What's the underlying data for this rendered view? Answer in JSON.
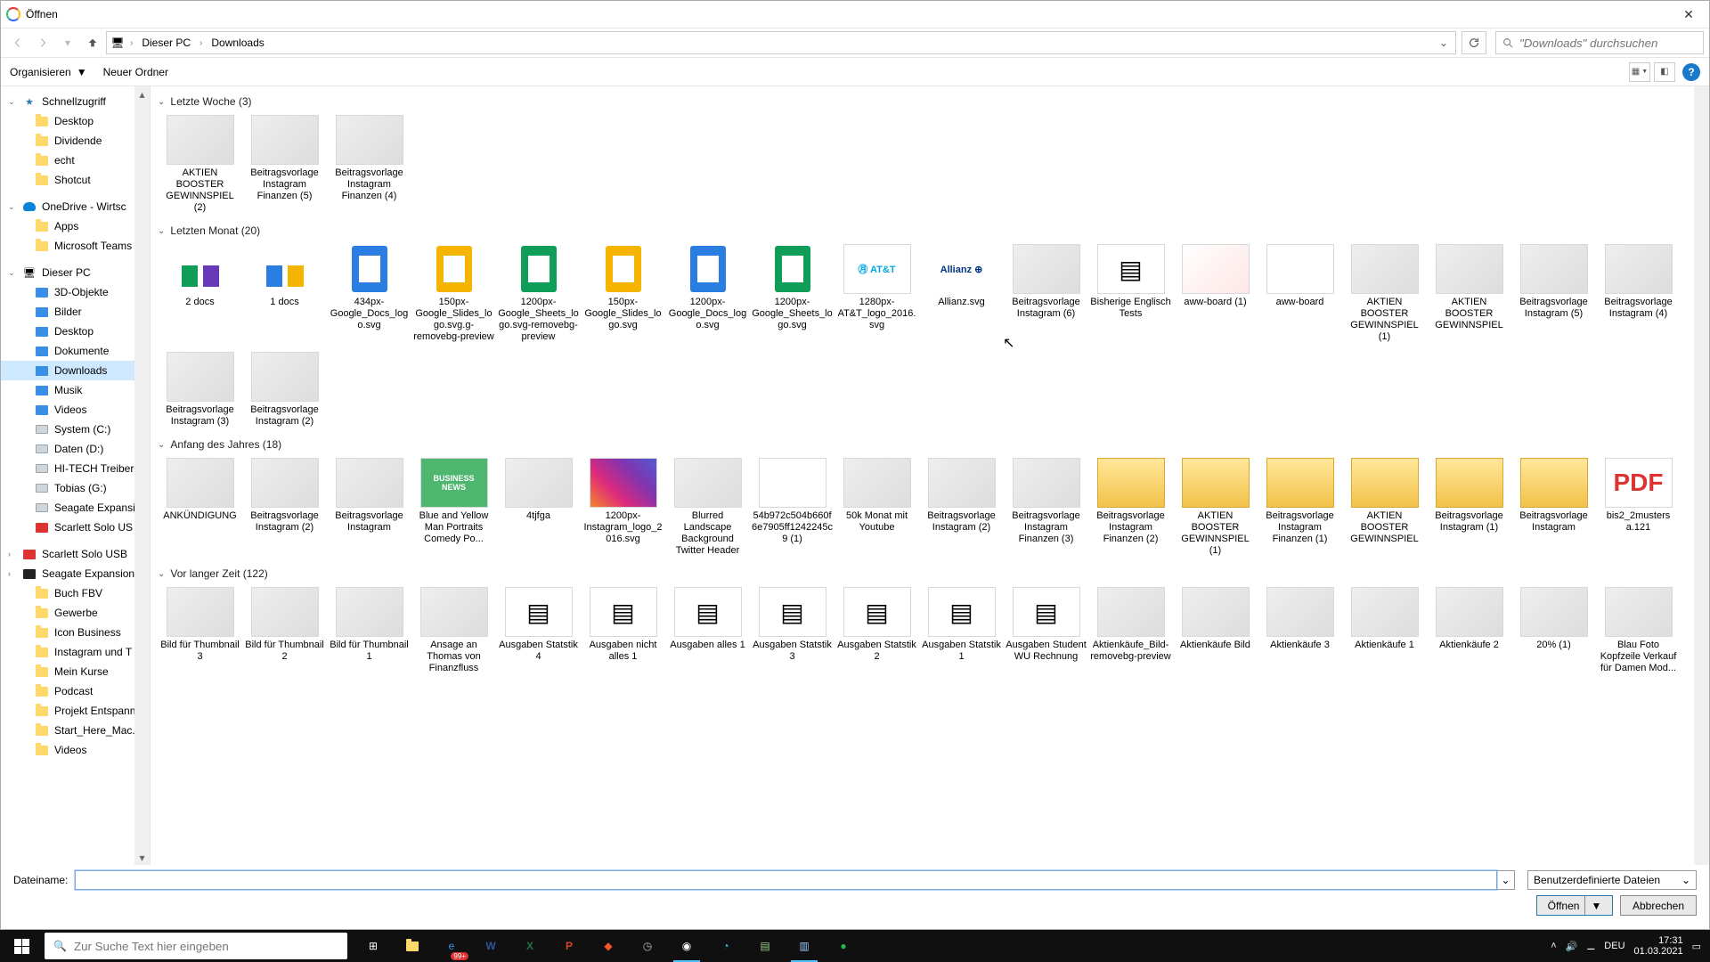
{
  "window": {
    "title": "Öffnen"
  },
  "nav": {
    "path_root_icon": "pc",
    "crumbs": [
      "Dieser PC",
      "Downloads"
    ],
    "search_placeholder": "\"Downloads\" durchsuchen"
  },
  "toolbar": {
    "organize": "Organisieren",
    "new_folder": "Neuer Ordner"
  },
  "sidebar": {
    "quick_access": "Schnellzugriff",
    "quick_items": [
      "Desktop",
      "Dividende",
      "echt",
      "Shotcut"
    ],
    "onedrive": "OneDrive - Wirtsc",
    "onedrive_items": [
      "Apps",
      "Microsoft Teams"
    ],
    "this_pc": "Dieser PC",
    "this_pc_items": [
      {
        "label": "3D-Objekte",
        "kind": "blue"
      },
      {
        "label": "Bilder",
        "kind": "blue"
      },
      {
        "label": "Desktop",
        "kind": "blue"
      },
      {
        "label": "Dokumente",
        "kind": "blue"
      },
      {
        "label": "Downloads",
        "kind": "blue",
        "selected": true
      },
      {
        "label": "Musik",
        "kind": "blue"
      },
      {
        "label": "Videos",
        "kind": "blue"
      },
      {
        "label": "System (C:)",
        "kind": "drive"
      },
      {
        "label": "Daten (D:)",
        "kind": "drive"
      },
      {
        "label": "HI-TECH Treiber",
        "kind": "drive"
      },
      {
        "label": "Tobias (G:)",
        "kind": "drive"
      },
      {
        "label": "Seagate Expansi",
        "kind": "drive"
      },
      {
        "label": "Scarlett Solo US",
        "kind": "red"
      }
    ],
    "extra": [
      {
        "label": "Scarlett Solo USB",
        "kind": "red"
      },
      {
        "label": "Seagate Expansion",
        "kind": "black"
      }
    ],
    "extra_items": [
      "Buch FBV",
      "Gewerbe",
      "Icon Business",
      "Instagram und T",
      "Mein Kurse",
      "Podcast",
      "Projekt Entspann",
      "Start_Here_Mac.",
      "Videos"
    ]
  },
  "groups": [
    {
      "title": "Letzte Woche",
      "count": "(3)",
      "items": [
        {
          "label": "AKTIEN BOOSTER GEWINNSPIEL (2)",
          "thumb": "poster"
        },
        {
          "label": "Beitragsvorlage Instagram Finanzen (5)",
          "thumb": "poster"
        },
        {
          "label": "Beitragsvorlage Instagram Finanzen (4)",
          "thumb": "poster"
        }
      ]
    },
    {
      "title": "Letzten Monat",
      "count": "(20)",
      "items": [
        {
          "label": "2 docs",
          "thumb": "minidocs2"
        },
        {
          "label": "1 docs",
          "thumb": "minidocs1"
        },
        {
          "label": "434px-Google_Docs_logo.svg",
          "thumb": "gdoc-blue"
        },
        {
          "label": "150px-Google_Slides_logo.svg.g-removebg-preview",
          "thumb": "gdoc-yellow"
        },
        {
          "label": "1200px-Google_Sheets_logo.svg-removebg-preview",
          "thumb": "gdoc-green"
        },
        {
          "label": "150px-Google_Slides_logo.svg",
          "thumb": "gdoc-yellow"
        },
        {
          "label": "1200px-Google_Docs_logo.svg",
          "thumb": "gdoc-blue"
        },
        {
          "label": "1200px-Google_Sheets_logo.svg",
          "thumb": "gdoc-green"
        },
        {
          "label": "1280px-AT&T_logo_2016.svg",
          "thumb": "att"
        },
        {
          "label": "Allianz.svg",
          "thumb": "allianz"
        },
        {
          "label": "Beitragsvorlage Instagram (6)",
          "thumb": "poster"
        },
        {
          "label": "Bisherige Englisch Tests",
          "thumb": "chart"
        },
        {
          "label": "aww-board (1)",
          "thumb": "pink"
        },
        {
          "label": "aww-board",
          "thumb": "blank"
        },
        {
          "label": "AKTIEN BOOSTER GEWINNSPIEL (1)",
          "thumb": "poster"
        },
        {
          "label": "AKTIEN BOOSTER GEWINNSPIEL",
          "thumb": "poster"
        },
        {
          "label": "Beitragsvorlage Instagram (5)",
          "thumb": "poster"
        },
        {
          "label": "Beitragsvorlage Instagram (4)",
          "thumb": "poster"
        },
        {
          "label": "Beitragsvorlage Instagram (3)",
          "thumb": "poster"
        },
        {
          "label": "Beitragsvorlage Instagram (2)",
          "thumb": "poster"
        }
      ]
    },
    {
      "title": "Anfang des Jahres",
      "count": "(18)",
      "items": [
        {
          "label": "ANKÜNDIGUNG",
          "thumb": "poster"
        },
        {
          "label": "Beitragsvorlage Instagram (2)",
          "thumb": "poster"
        },
        {
          "label": "Beitragsvorlage Instagram",
          "thumb": "poster"
        },
        {
          "label": "Blue and Yellow Man Portraits Comedy Po...",
          "thumb": "greenbiz"
        },
        {
          "label": "4tjfga",
          "thumb": "img"
        },
        {
          "label": "1200px-Instagram_logo_2016.svg",
          "thumb": "insta"
        },
        {
          "label": "Blurred Landscape Background Twitter Header",
          "thumb": "img"
        },
        {
          "label": "54b972c504b660f6e7905ff1242245c9 (1)",
          "thumb": "blank"
        },
        {
          "label": "50k Monat mit Youtube",
          "thumb": "img"
        },
        {
          "label": "Beitragsvorlage Instagram (2)",
          "thumb": "poster"
        },
        {
          "label": "Beitragsvorlage Instagram Finanzen (3)",
          "thumb": "poster"
        },
        {
          "label": "Beitragsvorlage Instagram Finanzen (2)",
          "thumb": "folder"
        },
        {
          "label": "AKTIEN BOOSTER GEWINNSPIEL (1)",
          "thumb": "folder"
        },
        {
          "label": "Beitragsvorlage Instagram Finanzen (1)",
          "thumb": "folder"
        },
        {
          "label": "AKTIEN BOOSTER GEWINNSPIEL",
          "thumb": "folder"
        },
        {
          "label": "Beitragsvorlage Instagram (1)",
          "thumb": "folder"
        },
        {
          "label": "Beitragsvorlage Instagram",
          "thumb": "folder"
        },
        {
          "label": "bis2_2musters a.121",
          "thumb": "pdf"
        }
      ]
    },
    {
      "title": "Vor langer Zeit",
      "count": "(122)",
      "items": [
        {
          "label": "Bild für Thumbnail 3",
          "thumb": "img"
        },
        {
          "label": "Bild für Thumbnail 2",
          "thumb": "img"
        },
        {
          "label": "Bild für Thumbnail 1",
          "thumb": "img"
        },
        {
          "label": "Ansage an Thomas von Finanzfluss",
          "thumb": "img"
        },
        {
          "label": "Ausgaben Statstik 4",
          "thumb": "chart"
        },
        {
          "label": "Ausgaben nicht alles 1",
          "thumb": "chart"
        },
        {
          "label": "Ausgaben alles 1",
          "thumb": "chart"
        },
        {
          "label": "Ausgaben Statstik 3",
          "thumb": "chart"
        },
        {
          "label": "Ausgaben Statstik 2",
          "thumb": "chart"
        },
        {
          "label": "Ausgaben Statstik 1",
          "thumb": "chart"
        },
        {
          "label": "Ausgaben Student WU Rechnung",
          "thumb": "chart"
        },
        {
          "label": "Aktienkäufe_Bild-removebg-preview",
          "thumb": "img"
        },
        {
          "label": "Aktienkäufe Bild",
          "thumb": "img"
        },
        {
          "label": "Aktienkäufe 3",
          "thumb": "poster"
        },
        {
          "label": "Aktienkäufe 1",
          "thumb": "poster"
        },
        {
          "label": "Aktienkäufe 2",
          "thumb": "poster"
        },
        {
          "label": "20% (1)",
          "thumb": "poster"
        },
        {
          "label": "Blau Foto Kopfzeile Verkauf für Damen Mod...",
          "thumb": "poster"
        }
      ]
    }
  ],
  "filename": {
    "label": "Dateiname:",
    "value": "",
    "filter": "Benutzerdefinierte Dateien"
  },
  "buttons": {
    "open": "Öffnen",
    "cancel": "Abbrechen"
  },
  "taskbar": {
    "search_placeholder": "Zur Suche Text hier eingeben",
    "badge": "99+",
    "lang": "DEU",
    "time": "17:31",
    "date": "01.03.2021"
  }
}
